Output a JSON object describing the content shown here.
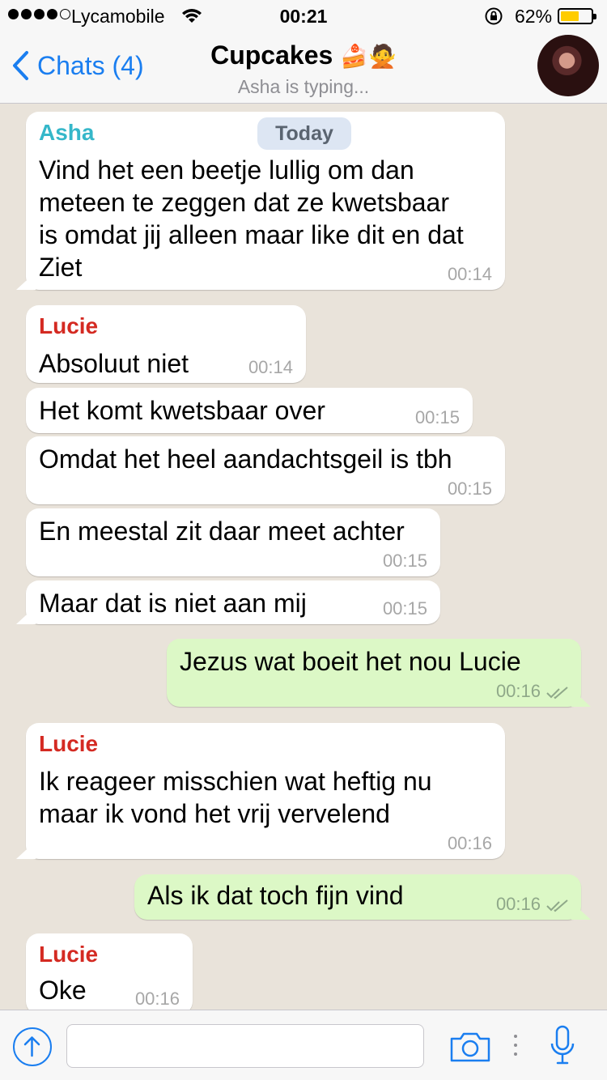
{
  "status": {
    "carrier": "Lycamobile",
    "time": "00:21",
    "battery_percent": "62%",
    "battery_level": 0.62,
    "battery_color": "#ffcc00"
  },
  "header": {
    "back_label": "Chats (4)",
    "title": "Cupcakes",
    "title_emoji": "🍰🙅",
    "subtitle": "Asha is typing..."
  },
  "date_divider": "Today",
  "messages": [
    {
      "sender": "Asha",
      "text": "Vind het een beetje lullig om dan\nmeteen te zeggen dat ze kwetsbaar\nis omdat jij alleen maar like dit en dat\nZiet",
      "time": "00:14"
    },
    {
      "sender": "Lucie",
      "text": "Absoluut niet",
      "time": "00:14"
    },
    {
      "text": "Het komt kwetsbaar over",
      "time": "00:15"
    },
    {
      "text": "Omdat het heel aandachtsgeil is tbh",
      "time": "00:15"
    },
    {
      "text": "En meestal zit daar meet achter",
      "time": "00:15"
    },
    {
      "text": "Maar dat is niet aan mij",
      "time": "00:15"
    },
    {
      "outgoing": true,
      "text": "Jezus wat boeit het nou Lucie",
      "time": "00:16"
    },
    {
      "sender": "Lucie",
      "text": "Ik reageer misschien wat heftig nu\nmaar ik vond het vrij vervelend",
      "time": "00:16"
    },
    {
      "outgoing": true,
      "text": "Als ik dat toch fijn vind",
      "time": "00:16"
    },
    {
      "sender": "Lucie",
      "text": "Oke",
      "time": "00:16"
    }
  ],
  "colors": {
    "accent": "#1a7ef0",
    "asha": "#35b7c9",
    "lucie": "#d42a22",
    "outgoing_bubble": "#dcf8c6"
  },
  "icons": [
    "wifi-icon",
    "rotation-lock-icon",
    "chevron-left-icon",
    "upload-icon",
    "camera-icon",
    "more-dots-icon",
    "microphone-icon",
    "double-check-icon"
  ],
  "input": {
    "placeholder": ""
  }
}
